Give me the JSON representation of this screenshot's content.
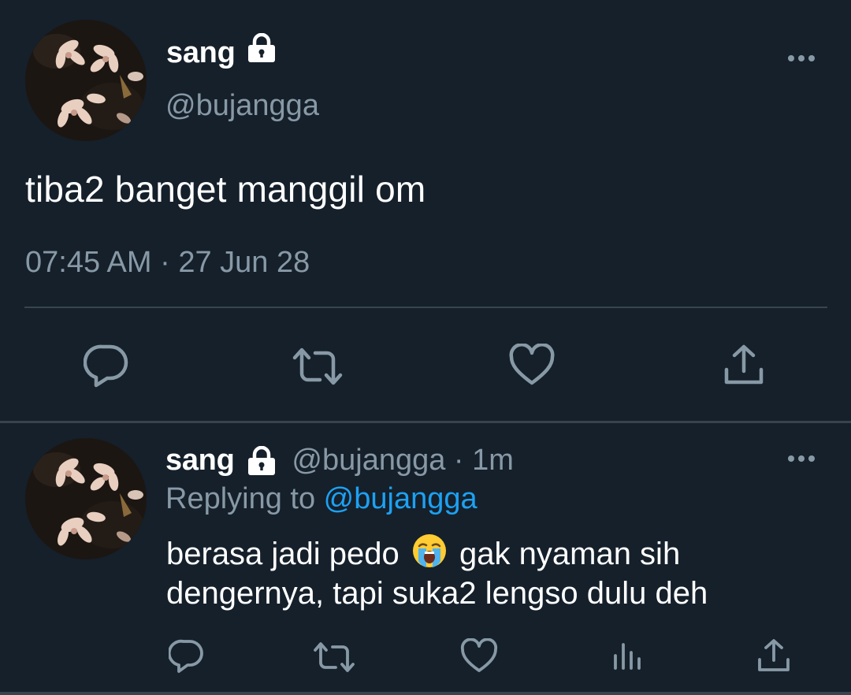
{
  "tweet": {
    "display_name": "sang",
    "handle": "@bujangga",
    "text": "tiba2 banget manggil om",
    "timestamp": "07:45 AM · 27 Jun 28",
    "icons": {
      "lock": "lock-icon",
      "more": "more-options-icon",
      "reply": "reply-icon",
      "retweet": "retweet-icon",
      "like": "like-icon",
      "share": "share-icon"
    }
  },
  "reply": {
    "display_name": "sang",
    "handle_time": "@bujangga · 1m",
    "replying_prefix": "Replying to ",
    "replying_mention": "@bujangga",
    "text_before_emoji": "berasa jadi pedo",
    "emoji": "loudly-crying-face",
    "text_after_emoji": "gak nyaman sih dengernya, tapi suka2 lengso dulu deh",
    "icons": {
      "reply": "reply-icon",
      "retweet": "retweet-icon",
      "like": "like-icon",
      "stats": "analytics-icon",
      "share": "share-icon"
    }
  },
  "colors": {
    "background": "#15202b",
    "text_primary": "#ffffff",
    "text_secondary": "#8899a6",
    "accent": "#1da1f2",
    "divider": "#38444d"
  }
}
